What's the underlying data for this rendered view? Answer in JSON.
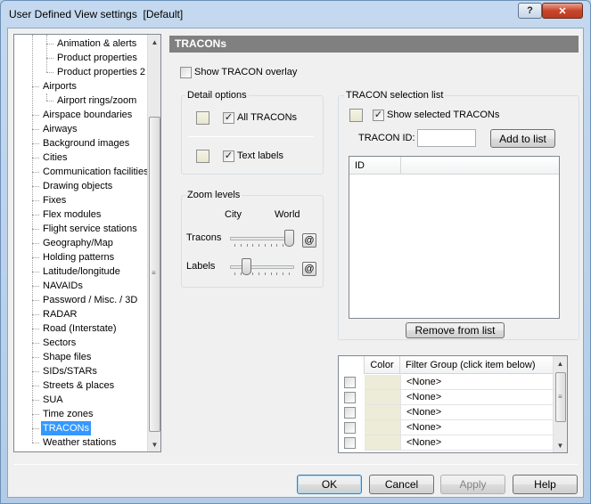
{
  "window": {
    "title": "User Defined View settings  [Default]",
    "help_glyph": "?",
    "close_glyph": "✕"
  },
  "tree": {
    "items": [
      {
        "label": "Animation & alerts",
        "level": 2
      },
      {
        "label": "Product properties",
        "level": 2
      },
      {
        "label": "Product properties 2",
        "level": 2
      },
      {
        "label": "Airports",
        "level": 1
      },
      {
        "label": "Airport rings/zoom",
        "level": 2
      },
      {
        "label": "Airspace boundaries",
        "level": 1
      },
      {
        "label": "Airways",
        "level": 1
      },
      {
        "label": "Background images",
        "level": 1
      },
      {
        "label": "Cities",
        "level": 1
      },
      {
        "label": "Communication facilities",
        "level": 1
      },
      {
        "label": "Drawing objects",
        "level": 1
      },
      {
        "label": "Fixes",
        "level": 1
      },
      {
        "label": "Flex modules",
        "level": 1
      },
      {
        "label": "Flight service stations",
        "level": 1
      },
      {
        "label": "Geography/Map",
        "level": 1
      },
      {
        "label": "Holding patterns",
        "level": 1
      },
      {
        "label": "Latitude/longitude",
        "level": 1
      },
      {
        "label": "NAVAIDs",
        "level": 1
      },
      {
        "label": "Password / Misc. / 3D",
        "level": 1
      },
      {
        "label": "RADAR",
        "level": 1
      },
      {
        "label": "Road (Interstate)",
        "level": 1
      },
      {
        "label": "Sectors",
        "level": 1
      },
      {
        "label": "Shape files",
        "level": 1
      },
      {
        "label": "SIDs/STARs",
        "level": 1
      },
      {
        "label": "Streets & places",
        "level": 1
      },
      {
        "label": "SUA",
        "level": 1
      },
      {
        "label": "Time zones",
        "level": 1
      },
      {
        "label": "TRACONs",
        "level": 1,
        "selected": true
      },
      {
        "label": "Weather stations",
        "level": 1
      }
    ],
    "scroll_up": "▲",
    "scroll_down": "▼",
    "grip": "≡"
  },
  "panel": {
    "header": "TRACONs",
    "show_overlay": {
      "label": "Show TRACON overlay",
      "checked": false
    },
    "detail_options": {
      "title": "Detail options",
      "all_tracons": {
        "label": "All TRACONs",
        "checked": true
      },
      "text_labels": {
        "label": "Text labels",
        "checked": true
      }
    },
    "zoom_levels": {
      "title": "Zoom levels",
      "city_label": "City",
      "world_label": "World",
      "tracons_label": "Tracons",
      "labels_label": "Labels",
      "tracons_level": 1.0,
      "labels_level": 0.22,
      "at_glyph": "@"
    },
    "selection_list": {
      "title": "TRACON selection list",
      "show_selected": {
        "label": "Show selected TRACONs",
        "checked": true
      },
      "tracon_id_label": "TRACON ID:",
      "tracon_id_value": "",
      "add_button": "Add to list",
      "column_id": "ID",
      "remove_button": "Remove from list"
    },
    "filter_grid": {
      "col_color": "Color",
      "col_filter": "Filter Group (click item below)",
      "rows": [
        "<None>",
        "<None>",
        "<None>",
        "<None>",
        "<None>"
      ],
      "check_glyph": "✓"
    }
  },
  "footer": {
    "ok": "OK",
    "cancel": "Cancel",
    "apply": "Apply",
    "help": "Help"
  },
  "colors": {
    "selection": "#3399ff",
    "header_bg": "#808080",
    "swatch": "#ececd8"
  }
}
